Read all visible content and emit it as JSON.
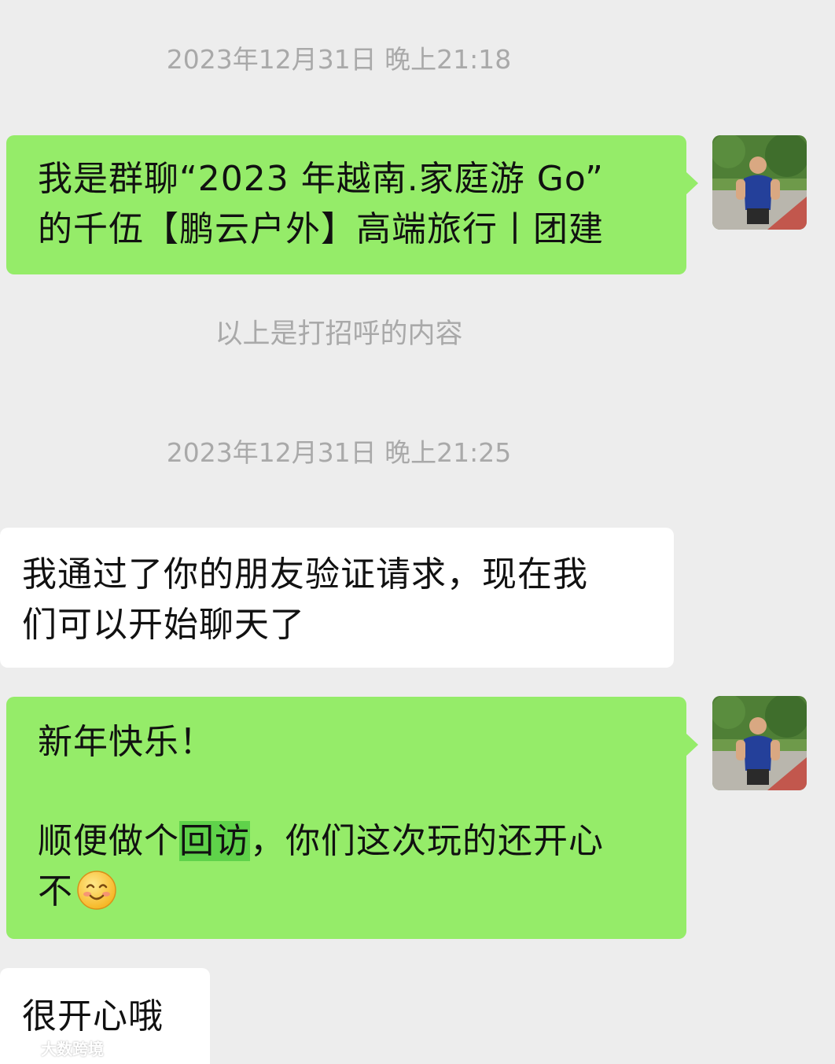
{
  "messages": [
    {
      "type": "timestamp",
      "text": "2023年12月31日 晚上21:18"
    },
    {
      "type": "outgoing",
      "lines": [
        "我是群聊“2023 年越南.家庭游 Go”",
        "的千伍【鹏云户外】高端旅行丨团建"
      ]
    },
    {
      "type": "system",
      "text": "以上是打招呼的内容"
    },
    {
      "type": "timestamp",
      "text": "2023年12月31日 晚上21:25"
    },
    {
      "type": "incoming",
      "lines": [
        "我通过了你的朋友验证请求，现在我",
        "们可以开始聊天了"
      ]
    },
    {
      "type": "outgoing",
      "line1": "新年快乐！",
      "line2_before": "顺便做个",
      "line2_highlight": "回访",
      "line2_after": "，你们这次玩的还开心",
      "line3": "不",
      "emoji": "smiling-face-emoji"
    },
    {
      "type": "incoming",
      "lines": [
        "很开心哦"
      ]
    }
  ],
  "watermark": {
    "text": "大数跨境"
  },
  "colors": {
    "background": "#ededed",
    "outgoing_bubble": "#95ec69",
    "incoming_bubble": "#ffffff",
    "timestamp_text": "#a9a9a9",
    "highlight": "#5fd24a"
  }
}
